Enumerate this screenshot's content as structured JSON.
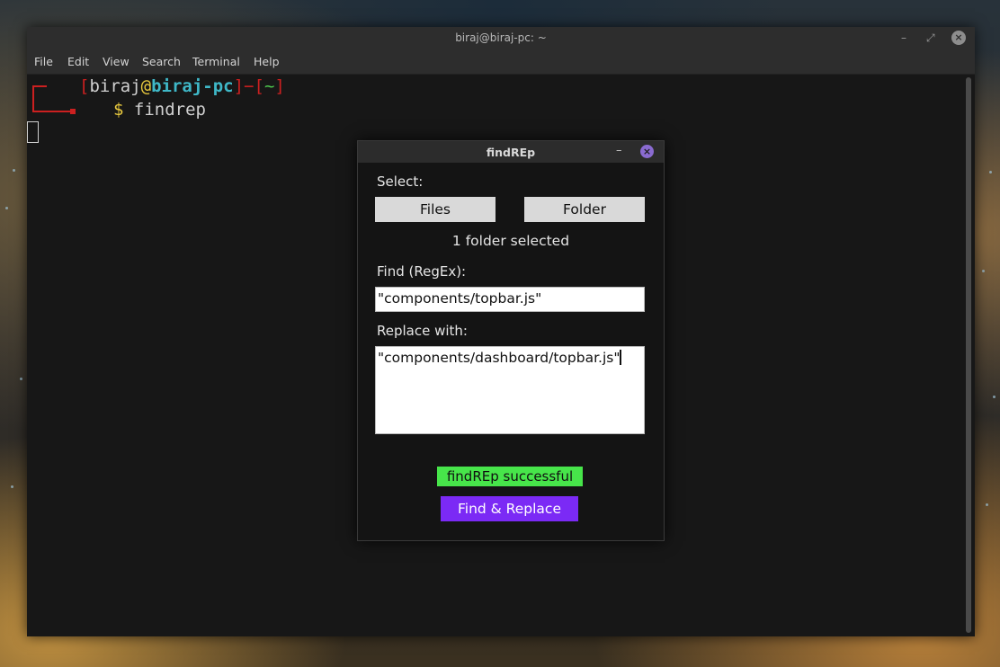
{
  "terminal": {
    "title": "biraj@biraj-pc: ~",
    "menu": [
      "File",
      "Edit",
      "View",
      "Search",
      "Terminal",
      "Help"
    ],
    "prompt": {
      "user": "biraj",
      "at": "@",
      "host": "biraj-pc",
      "dir": "~",
      "symbol": "$",
      "command": "findrep"
    }
  },
  "dialog": {
    "title": "findREp",
    "minimize_label": "–",
    "close_label": "×",
    "select_label": "Select:",
    "files_button": "Files",
    "folder_button": "Folder",
    "selection_status": "1 folder selected",
    "find_label": "Find (RegEx):",
    "find_value": "\"components/topbar.js\"",
    "replace_label": "Replace with:",
    "replace_value": "\"components/dashboard/topbar.js\"",
    "result_status": "findREp successful",
    "action_button": "Find & Replace"
  },
  "colors": {
    "success": "#47e54a",
    "action": "#7b2af5",
    "prompt_red": "#cc2020",
    "prompt_cyan": "#3fb8c8",
    "prompt_yellow": "#e8c93e"
  }
}
